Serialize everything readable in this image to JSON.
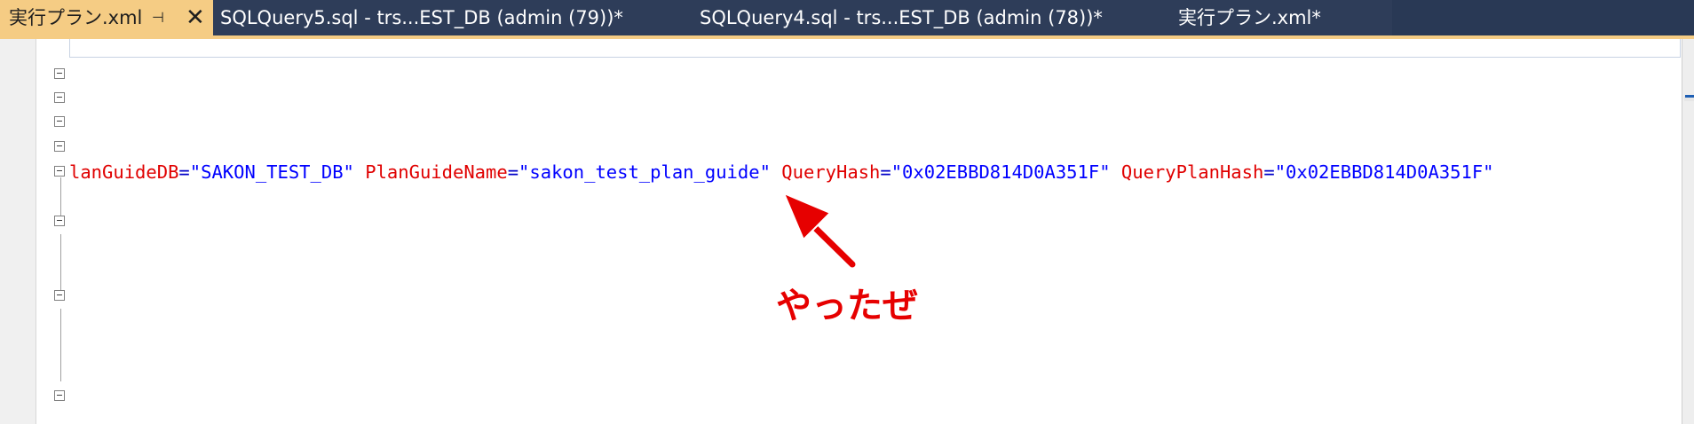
{
  "tabs": [
    {
      "title": "実行プラン.xml",
      "active": true,
      "pin_glyph": "⊣",
      "close_glyph": "✕"
    },
    {
      "title": "SQLQuery5.sql - trs...EST_DB (admin (79))*"
    },
    {
      "title": "SQLQuery4.sql - trs...EST_DB (admin (78))*"
    },
    {
      "title": "実行プラン.xml*"
    }
  ],
  "code": {
    "attr1_name": "lanGuideDB",
    "attr1_value": "\"SAKON_TEST_DB\"",
    "attr2_name": "PlanGuideName",
    "attr2_value": "\"sakon_test_plan_guide\"",
    "attr3_name": "QueryHash",
    "attr3_value": "\"0x02EBBD814D0A351F\"",
    "attr4_name": "QueryPlanHash",
    "attr4_value": "\"0x02EBBD814D0A351F\"",
    "equals": "="
  },
  "annotation": {
    "text": "やったぜ",
    "color": "#e60000"
  },
  "colors": {
    "tab_bar_bg": "#2e3d59",
    "active_tab_bg": "#f5cc84",
    "xml_attribute": "#e00000",
    "xml_value": "#0000ff"
  },
  "icons": {
    "pin": "pin-icon",
    "close": "close-icon",
    "fold": "collapse-minus-icon"
  }
}
